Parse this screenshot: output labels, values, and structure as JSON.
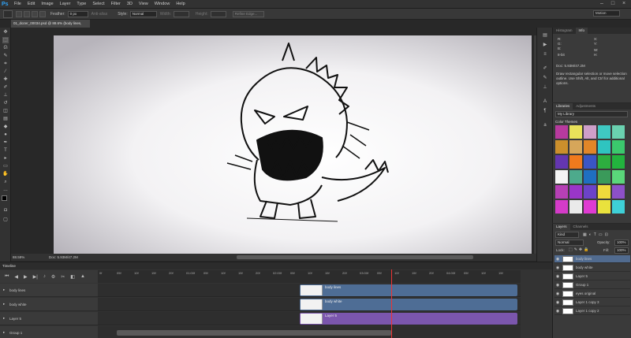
{
  "app": {
    "logo": "Ps"
  },
  "menu": [
    "File",
    "Edit",
    "Image",
    "Layer",
    "Type",
    "Select",
    "Filter",
    "3D",
    "View",
    "Window",
    "Help"
  ],
  "options_bar": {
    "feather_label": "Feather:",
    "feather_value": "0 px",
    "antialias_label": "Anti-alias",
    "style_label": "Style:",
    "style_value": "Normal",
    "width_label": "Width:",
    "height_label": "Height:",
    "refine_edge": "Refine Edge...",
    "workspace": "Motion"
  },
  "document": {
    "tab_title": "01_dozer_00034.psd @ 88.6% (body lines, RGB/8#)",
    "zoom": "88.59%",
    "doc_size": "Doc: 5.93M/47.2M"
  },
  "info_panel": {
    "tabs": [
      "Histogram",
      "Info"
    ],
    "active": "Info",
    "r_label": "R:",
    "g_label": "G:",
    "b_label": "B:",
    "bits": "8-bit",
    "x_label": "X:",
    "y_label": "Y:",
    "w_label": "W:",
    "h_label": "H:",
    "doc": "Doc: 5.93M/47.2M",
    "help": "Draw rectangular selection or move selection outline. Use Shift, Alt, and Ctrl for additional options."
  },
  "libraries": {
    "tabs": [
      "Libraries",
      "Adjustments"
    ],
    "library_name": "My Library",
    "section": "Color Themes",
    "swatches": [
      "#b73a9e",
      "#e9e25a",
      "#ce9fc9",
      "#3fc8c2",
      "#6ad1b0",
      "#cb8f2c",
      "#d6a65a",
      "#e28628",
      "#2fc4c0",
      "#3bc96d",
      "#6436b0",
      "#f07a1d",
      "#3a56c4",
      "#2dae3f",
      "#22b33e",
      "#f4f4f4",
      "#4daa8c",
      "#1f6fc0",
      "#3a9a5a",
      "#5ad67a",
      "#b640b5",
      "#9a36c8",
      "#6c43c9",
      "#f0da3c",
      "#8d50c8",
      "#d43bc8",
      "#eaeaea",
      "#df3bd2",
      "#e9e23d",
      "#3ed0d7"
    ]
  },
  "layers": {
    "tabs": [
      "Layers",
      "Channels"
    ],
    "filter_label": "Kind",
    "blend_mode": "Normal",
    "opacity_label": "Opacity:",
    "opacity": "100%",
    "lock_label": "Lock:",
    "fill_label": "Fill:",
    "fill": "100%",
    "items": [
      {
        "name": "body lines",
        "selected": true
      },
      {
        "name": "body white",
        "selected": false
      },
      {
        "name": "Layer 5",
        "selected": false
      },
      {
        "name": "Group 1",
        "selected": false
      },
      {
        "name": "eyes original",
        "selected": false
      },
      {
        "name": "Layer 1 copy 3",
        "selected": false
      },
      {
        "name": "Layer 1 copy 2",
        "selected": false
      }
    ]
  },
  "timeline": {
    "title": "Timeline",
    "ruler_ticks": [
      "0f",
      "05f",
      "10f",
      "15f",
      "20f",
      "01:00f",
      "05f",
      "10f",
      "15f",
      "20f",
      "02:00f",
      "05f",
      "10f",
      "15f",
      "20f",
      "03:00f",
      "05f",
      "10f",
      "15f",
      "20f",
      "04:00f",
      "05f",
      "10f",
      "15f"
    ],
    "tracks": [
      {
        "label": "body lines",
        "clip": "body lines",
        "color": "blue"
      },
      {
        "label": "body white",
        "clip": "body white",
        "color": "blue"
      },
      {
        "label": "Layer 5",
        "clip": "Layer 5",
        "color": "purple"
      },
      {
        "label": "Group 1",
        "clip": "",
        "color": "gray"
      }
    ]
  }
}
